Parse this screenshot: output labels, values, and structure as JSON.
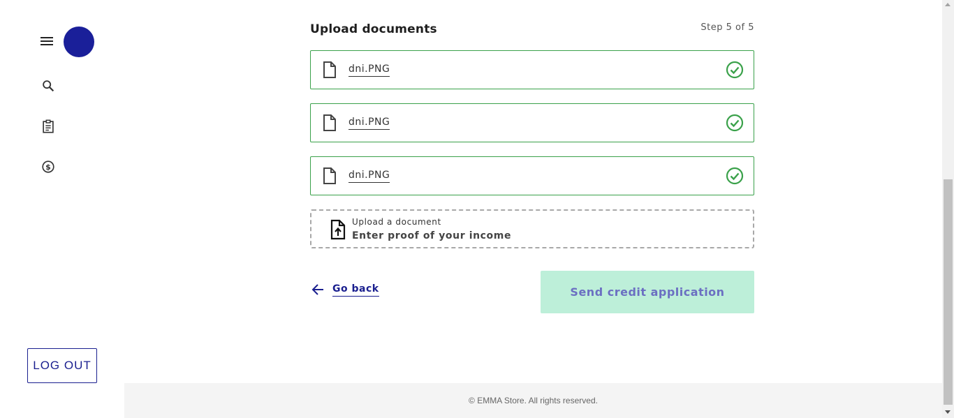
{
  "sidebar": {
    "menu_icon": "hamburger-menu-icon",
    "nav_icons": [
      "search-icon",
      "clipboard-icon",
      "dollar-circle-icon"
    ],
    "logout_label": "LOG OUT",
    "avatar_color": "#1a1f99"
  },
  "main": {
    "title": "Upload documents",
    "step": "Step 5 of 5",
    "files": [
      {
        "name": "dni.PNG",
        "status": "uploaded"
      },
      {
        "name": "dni.PNG",
        "status": "uploaded"
      },
      {
        "name": "dni.PNG",
        "status": "uploaded"
      }
    ],
    "upload": {
      "label": "Upload a document",
      "hint": "Enter proof of your income"
    },
    "go_back_label": "Go back",
    "send_label": "Send credit application"
  },
  "footer": {
    "text": "© EMMA Store. All rights reserved."
  },
  "colors": {
    "accent": "#1a1f8f",
    "success": "#3aa14a",
    "send_bg": "#bdefd9",
    "send_text": "#6b6fc2"
  }
}
